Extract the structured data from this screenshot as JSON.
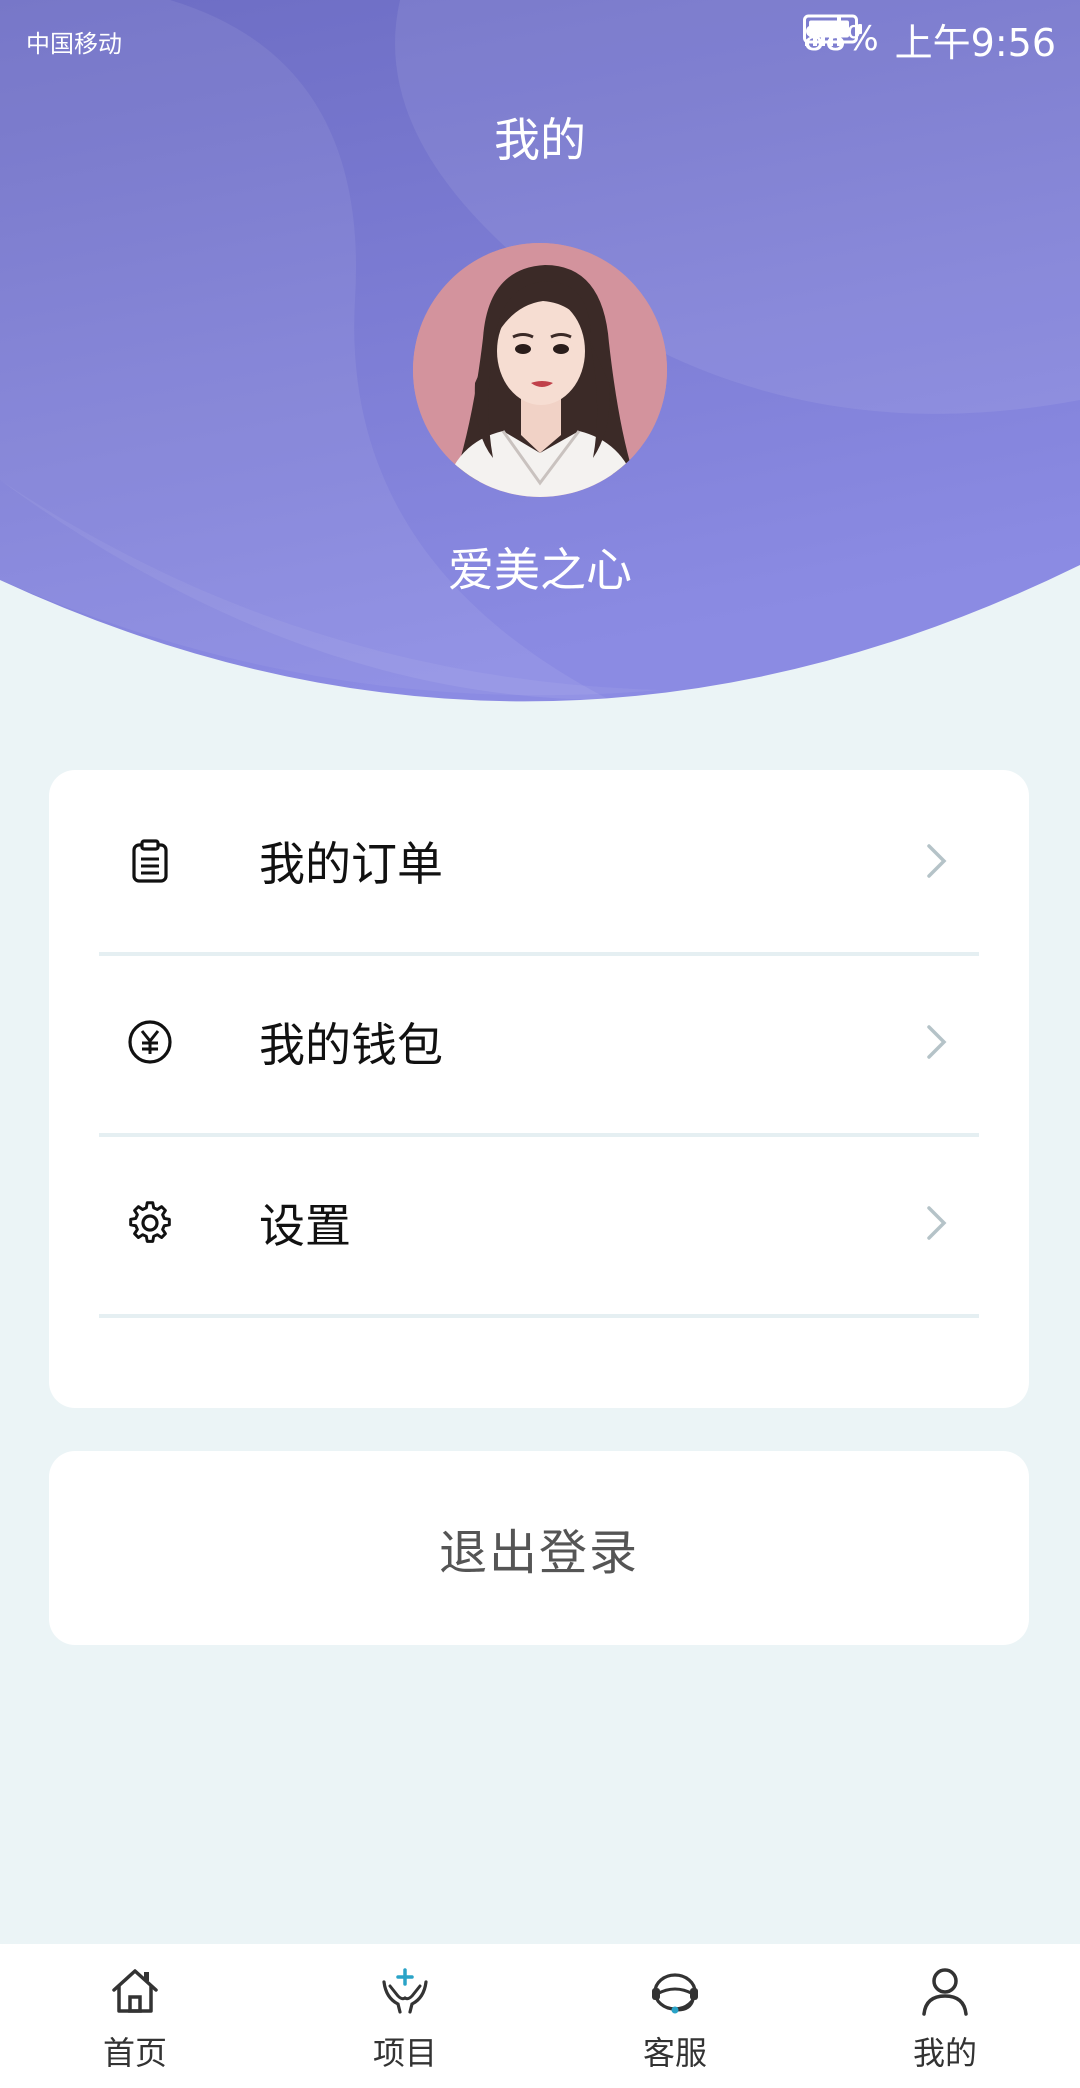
{
  "status_bar": {
    "carrier": "中国移动",
    "battery": "88%",
    "time": "上午9:56",
    "icons": [
      "signal-icon",
      "battery-icon"
    ]
  },
  "header": {
    "title": "我的",
    "username": "爱美之心",
    "gradient_colors": [
      "#6f6fc6",
      "#8a8ae2"
    ]
  },
  "menu": {
    "items": [
      {
        "label": "我的订单",
        "icon": "clipboard-icon"
      },
      {
        "label": "我的钱包",
        "icon": "yen-coin-icon"
      },
      {
        "label": "设置",
        "icon": "gear-icon"
      }
    ]
  },
  "logout": {
    "label": "退出登录"
  },
  "tab_bar": {
    "tabs": [
      {
        "label": "首页",
        "icon": "home-icon"
      },
      {
        "label": "项目",
        "icon": "hands-care-icon"
      },
      {
        "label": "客服",
        "icon": "headset-icon"
      },
      {
        "label": "我的",
        "icon": "person-icon"
      }
    ]
  }
}
